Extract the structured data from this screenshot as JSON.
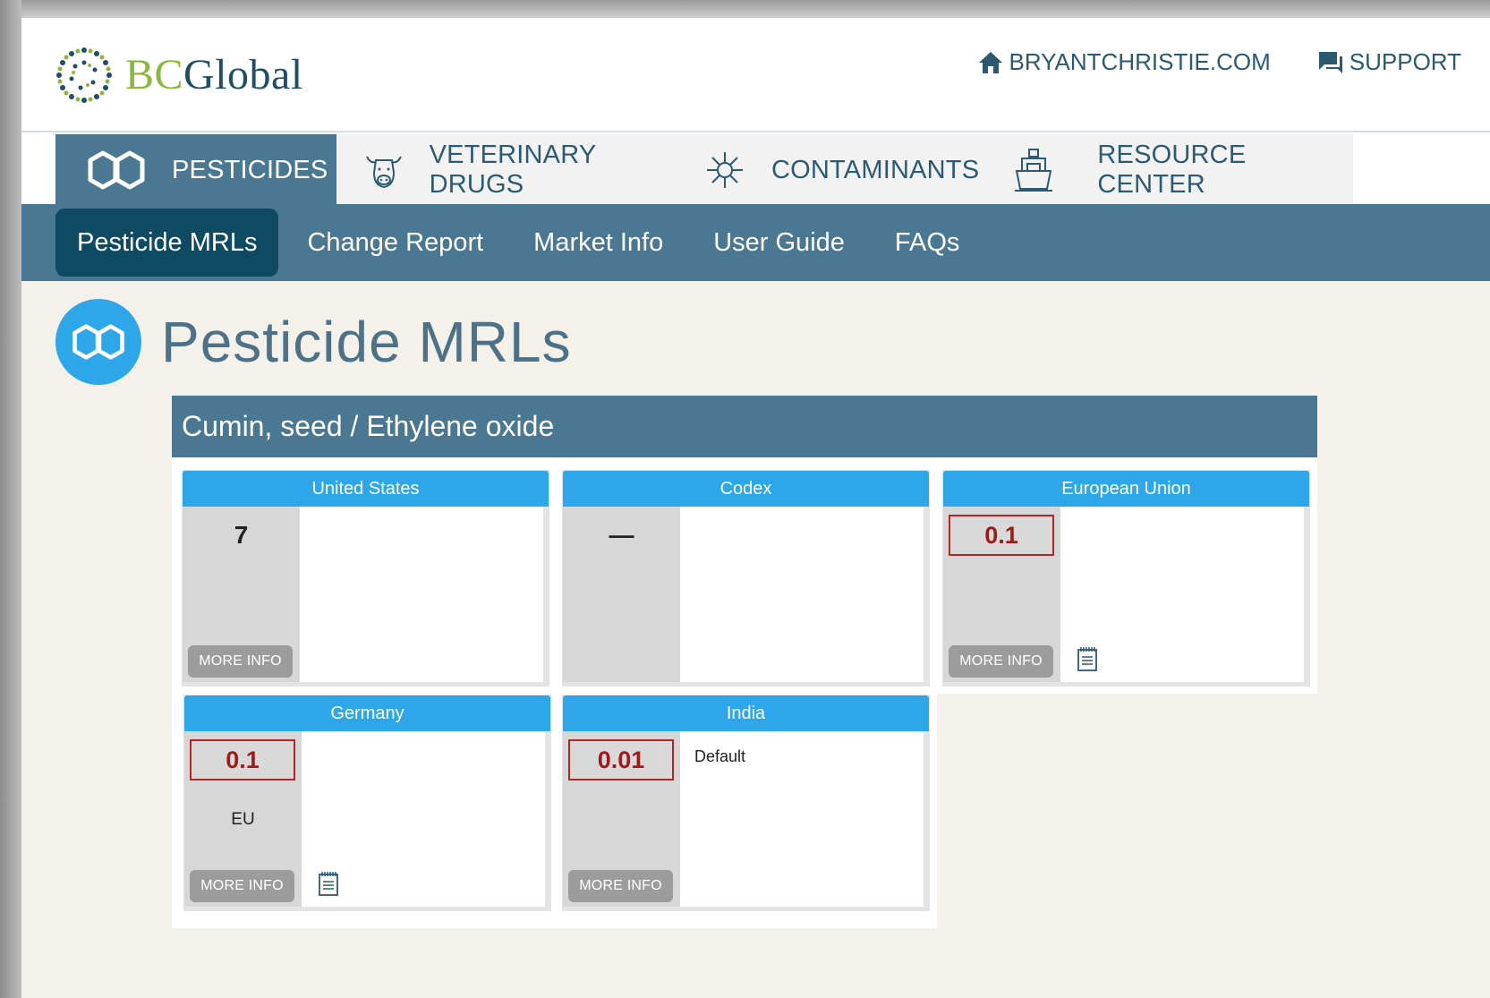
{
  "header": {
    "logo_bc": "BC",
    "logo_global": "Global",
    "links": [
      {
        "label": "BRYANTCHRISTIE.COM",
        "icon": "home-icon"
      },
      {
        "label": "SUPPORT",
        "icon": "chat-icon"
      }
    ]
  },
  "main_nav": {
    "tabs": [
      {
        "label": "PESTICIDES",
        "icon": "hexagon-rings-icon",
        "active": true
      },
      {
        "label": "VETERINARY DRUGS",
        "icon": "cow-icon",
        "active": false
      },
      {
        "label": "CONTAMINANTS",
        "icon": "virus-icon",
        "active": false
      },
      {
        "label": "RESOURCE CENTER",
        "icon": "ship-icon",
        "active": false
      }
    ]
  },
  "sub_nav": {
    "items": [
      {
        "label": "Pesticide MRLs",
        "active": true
      },
      {
        "label": "Change Report",
        "active": false
      },
      {
        "label": "Market Info",
        "active": false
      },
      {
        "label": "User Guide",
        "active": false
      },
      {
        "label": "FAQs",
        "active": false
      }
    ]
  },
  "page": {
    "title": "Pesticide MRLs",
    "panel_title": "Cumin, seed / Ethylene oxide"
  },
  "cards": [
    {
      "market": "United States",
      "mrl": "7",
      "highlight": false,
      "note": "",
      "right_text": "",
      "more_info": "MORE INFO",
      "has_notes_icon": false
    },
    {
      "market": "Codex",
      "mrl": "—",
      "highlight": false,
      "note": "",
      "right_text": "",
      "more_info": "",
      "has_notes_icon": false
    },
    {
      "market": "European Union",
      "mrl": "0.1",
      "highlight": true,
      "note": "",
      "right_text": "",
      "more_info": "MORE INFO",
      "has_notes_icon": true
    },
    {
      "market": "Germany",
      "mrl": "0.1",
      "highlight": true,
      "note": "EU",
      "right_text": "",
      "more_info": "MORE INFO",
      "has_notes_icon": true
    },
    {
      "market": "India",
      "mrl": "0.01",
      "highlight": true,
      "note": "",
      "right_text": "Default",
      "more_info": "MORE INFO",
      "has_notes_icon": false
    }
  ],
  "colors": {
    "nav_blue": "#4a7893",
    "nav_dark": "#0e4a62",
    "card_header": "#2da7ea",
    "mrl_red": "#9e1b1b",
    "content_bg": "#f3f1ea"
  }
}
